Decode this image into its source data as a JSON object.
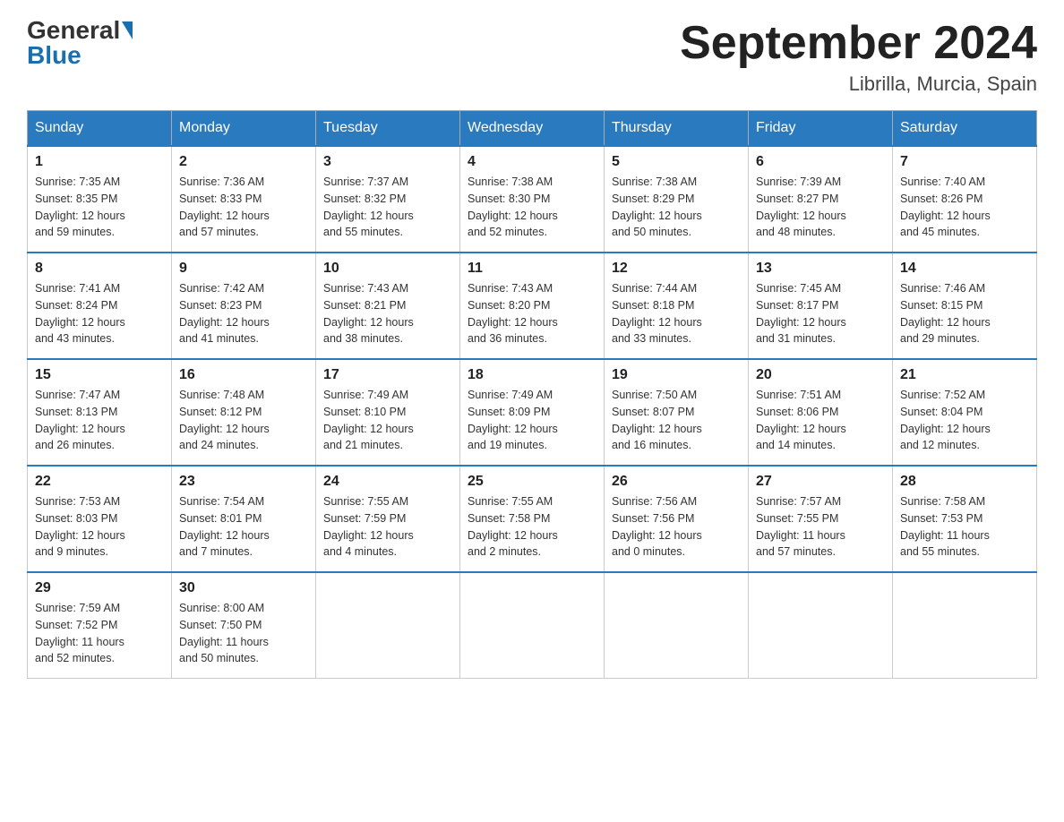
{
  "logo": {
    "general": "General",
    "blue": "Blue"
  },
  "title": "September 2024",
  "location": "Librilla, Murcia, Spain",
  "days_of_week": [
    "Sunday",
    "Monday",
    "Tuesday",
    "Wednesday",
    "Thursday",
    "Friday",
    "Saturday"
  ],
  "weeks": [
    [
      {
        "day": "1",
        "sunrise": "7:35 AM",
        "sunset": "8:35 PM",
        "daylight": "12 hours and 59 minutes."
      },
      {
        "day": "2",
        "sunrise": "7:36 AM",
        "sunset": "8:33 PM",
        "daylight": "12 hours and 57 minutes."
      },
      {
        "day": "3",
        "sunrise": "7:37 AM",
        "sunset": "8:32 PM",
        "daylight": "12 hours and 55 minutes."
      },
      {
        "day": "4",
        "sunrise": "7:38 AM",
        "sunset": "8:30 PM",
        "daylight": "12 hours and 52 minutes."
      },
      {
        "day": "5",
        "sunrise": "7:38 AM",
        "sunset": "8:29 PM",
        "daylight": "12 hours and 50 minutes."
      },
      {
        "day": "6",
        "sunrise": "7:39 AM",
        "sunset": "8:27 PM",
        "daylight": "12 hours and 48 minutes."
      },
      {
        "day": "7",
        "sunrise": "7:40 AM",
        "sunset": "8:26 PM",
        "daylight": "12 hours and 45 minutes."
      }
    ],
    [
      {
        "day": "8",
        "sunrise": "7:41 AM",
        "sunset": "8:24 PM",
        "daylight": "12 hours and 43 minutes."
      },
      {
        "day": "9",
        "sunrise": "7:42 AM",
        "sunset": "8:23 PM",
        "daylight": "12 hours and 41 minutes."
      },
      {
        "day": "10",
        "sunrise": "7:43 AM",
        "sunset": "8:21 PM",
        "daylight": "12 hours and 38 minutes."
      },
      {
        "day": "11",
        "sunrise": "7:43 AM",
        "sunset": "8:20 PM",
        "daylight": "12 hours and 36 minutes."
      },
      {
        "day": "12",
        "sunrise": "7:44 AM",
        "sunset": "8:18 PM",
        "daylight": "12 hours and 33 minutes."
      },
      {
        "day": "13",
        "sunrise": "7:45 AM",
        "sunset": "8:17 PM",
        "daylight": "12 hours and 31 minutes."
      },
      {
        "day": "14",
        "sunrise": "7:46 AM",
        "sunset": "8:15 PM",
        "daylight": "12 hours and 29 minutes."
      }
    ],
    [
      {
        "day": "15",
        "sunrise": "7:47 AM",
        "sunset": "8:13 PM",
        "daylight": "12 hours and 26 minutes."
      },
      {
        "day": "16",
        "sunrise": "7:48 AM",
        "sunset": "8:12 PM",
        "daylight": "12 hours and 24 minutes."
      },
      {
        "day": "17",
        "sunrise": "7:49 AM",
        "sunset": "8:10 PM",
        "daylight": "12 hours and 21 minutes."
      },
      {
        "day": "18",
        "sunrise": "7:49 AM",
        "sunset": "8:09 PM",
        "daylight": "12 hours and 19 minutes."
      },
      {
        "day": "19",
        "sunrise": "7:50 AM",
        "sunset": "8:07 PM",
        "daylight": "12 hours and 16 minutes."
      },
      {
        "day": "20",
        "sunrise": "7:51 AM",
        "sunset": "8:06 PM",
        "daylight": "12 hours and 14 minutes."
      },
      {
        "day": "21",
        "sunrise": "7:52 AM",
        "sunset": "8:04 PM",
        "daylight": "12 hours and 12 minutes."
      }
    ],
    [
      {
        "day": "22",
        "sunrise": "7:53 AM",
        "sunset": "8:03 PM",
        "daylight": "12 hours and 9 minutes."
      },
      {
        "day": "23",
        "sunrise": "7:54 AM",
        "sunset": "8:01 PM",
        "daylight": "12 hours and 7 minutes."
      },
      {
        "day": "24",
        "sunrise": "7:55 AM",
        "sunset": "7:59 PM",
        "daylight": "12 hours and 4 minutes."
      },
      {
        "day": "25",
        "sunrise": "7:55 AM",
        "sunset": "7:58 PM",
        "daylight": "12 hours and 2 minutes."
      },
      {
        "day": "26",
        "sunrise": "7:56 AM",
        "sunset": "7:56 PM",
        "daylight": "12 hours and 0 minutes."
      },
      {
        "day": "27",
        "sunrise": "7:57 AM",
        "sunset": "7:55 PM",
        "daylight": "11 hours and 57 minutes."
      },
      {
        "day": "28",
        "sunrise": "7:58 AM",
        "sunset": "7:53 PM",
        "daylight": "11 hours and 55 minutes."
      }
    ],
    [
      {
        "day": "29",
        "sunrise": "7:59 AM",
        "sunset": "7:52 PM",
        "daylight": "11 hours and 52 minutes."
      },
      {
        "day": "30",
        "sunrise": "8:00 AM",
        "sunset": "7:50 PM",
        "daylight": "11 hours and 50 minutes."
      },
      null,
      null,
      null,
      null,
      null
    ]
  ],
  "labels": {
    "sunrise": "Sunrise:",
    "sunset": "Sunset:",
    "daylight": "Daylight:"
  }
}
